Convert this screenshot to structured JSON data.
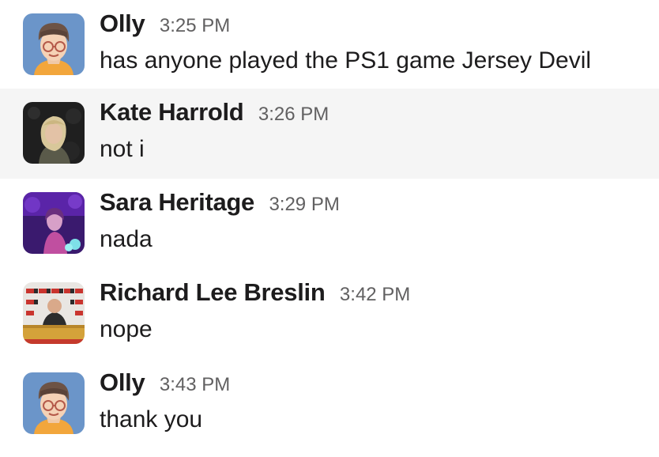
{
  "messages": [
    {
      "author": "Olly",
      "time": "3:25 PM",
      "text": "has anyone played the PS1 game Jersey Devil",
      "avatar_icon": "olly-cartoon-avatar",
      "highlighted": false
    },
    {
      "author": "Kate Harrold",
      "time": "3:26 PM",
      "text": "not i",
      "avatar_icon": "kate-photo-avatar",
      "highlighted": true
    },
    {
      "author": "Sara Heritage",
      "time": "3:29 PM",
      "text": "nada",
      "avatar_icon": "sara-photo-avatar",
      "highlighted": false
    },
    {
      "author": "Richard Lee Breslin",
      "time": "3:42 PM",
      "text": "nope",
      "avatar_icon": "richard-photo-avatar",
      "highlighted": false
    },
    {
      "author": "Olly",
      "time": "3:43 PM",
      "text": "thank you",
      "avatar_icon": "olly-cartoon-avatar",
      "highlighted": false
    }
  ],
  "colors": {
    "text": "#1d1c1d",
    "timestamp": "#616061",
    "hover_background": "#f5f5f5"
  }
}
